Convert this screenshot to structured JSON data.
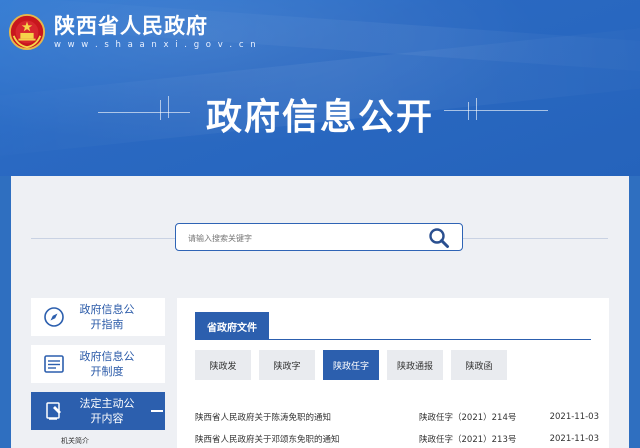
{
  "header": {
    "site_title": "陕西省人民政府",
    "site_url": "w w w . s h a a n x i . g o v . c n",
    "hero_title": "政府信息公开"
  },
  "search": {
    "placeholder": "请输入搜索关键字",
    "icon": "search-icon"
  },
  "sidebar": {
    "items": [
      {
        "label": "政府信息公开指南",
        "icon": "compass-icon",
        "active": false
      },
      {
        "label": "政府信息公开制度",
        "icon": "document-list-icon",
        "active": false
      },
      {
        "label": "法定主动公开内容",
        "icon": "gavel-icon",
        "active": true
      }
    ],
    "sub_item": "机关简介"
  },
  "content": {
    "section_tab": "省政府文件",
    "subtabs": [
      "陕政发",
      "陕政字",
      "陕政任字",
      "陕政通报",
      "陕政函"
    ],
    "active_subtab": "陕政任字",
    "documents": [
      {
        "title": "陕西省人民政府关于陈涛免职的通知",
        "number": "陕政任字（2021）214号",
        "date": "2021-11-03"
      },
      {
        "title": "陕西省人民政府关于邓颂东免职的通知",
        "number": "陕政任字（2021）213号",
        "date": "2021-11-03"
      }
    ]
  },
  "colors": {
    "banner_blue": "#2a69c2",
    "accent": "#2c5fae",
    "panel_bg": "#eef0f4"
  }
}
